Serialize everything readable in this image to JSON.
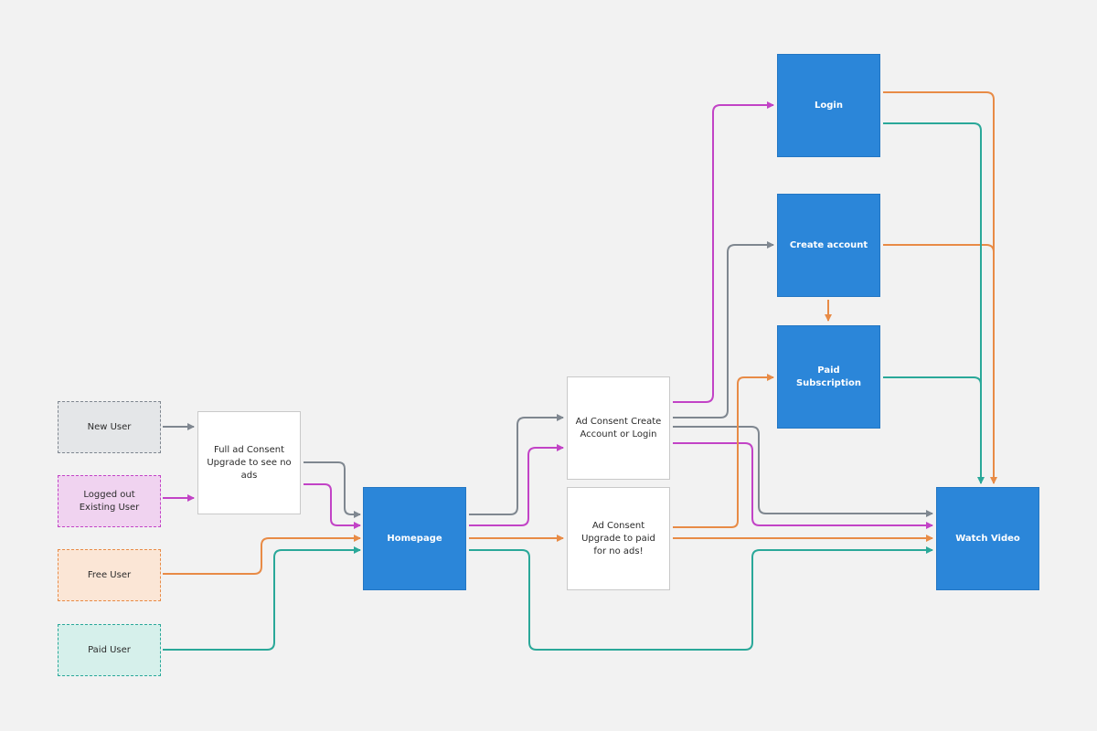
{
  "colors": {
    "background": "#f2f2f2",
    "gray": "#7f8790",
    "magenta": "#c243c6",
    "orange": "#e88b46",
    "teal": "#2aa899",
    "blue": "#2b86d9"
  },
  "nodes": {
    "new_user": "New User",
    "logged_out_user": "Logged out Existing User",
    "free_user": "Free User",
    "paid_user": "Paid User",
    "full_ad_consent": "Full ad Consent Upgrade to see no ads",
    "homepage": "Homepage",
    "ad_consent_create": "Ad Consent Create Account or Login",
    "ad_consent_upgrade": "Ad Consent Upgrade to paid for no ads!",
    "login": "Login",
    "create_account": "Create account",
    "paid_subscription": "Paid Subscription",
    "watch_video": "Watch Video"
  }
}
